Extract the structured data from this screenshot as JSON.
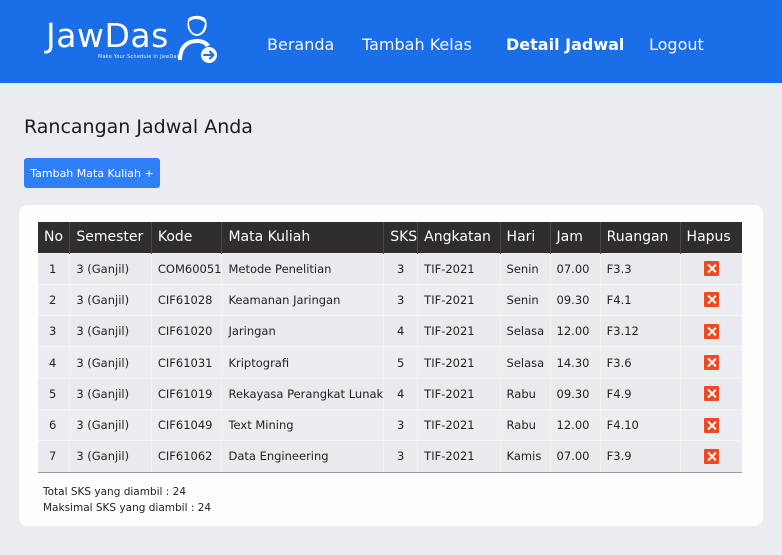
{
  "nav": {
    "brand": "JawDas",
    "tagline": "Make Your Schedule in JawDas",
    "links": [
      "Beranda",
      "Tambah Kelas",
      "Detail Jadwal",
      "Logout"
    ],
    "active": "Detail Jadwal"
  },
  "page": {
    "title": "Rancangan Jadwal Anda",
    "add_button": "Tambah Mata Kuliah +"
  },
  "table": {
    "headers": [
      "No",
      "Semester",
      "Kode",
      "Mata Kuliah",
      "SKS",
      "Angkatan",
      "Hari",
      "Jam",
      "Ruangan",
      "Hapus"
    ],
    "rows": [
      {
        "no": "1",
        "semester": "3 (Ganjil)",
        "kode": "COM60051",
        "matkul": "Metode Penelitian",
        "sks": "3",
        "angkatan": "TIF-2021",
        "hari": "Senin",
        "jam": "07.00",
        "ruangan": "F3.3"
      },
      {
        "no": "2",
        "semester": "3 (Ganjil)",
        "kode": "CIF61028",
        "matkul": "Keamanan Jaringan",
        "sks": "3",
        "angkatan": "TIF-2021",
        "hari": "Senin",
        "jam": "09.30",
        "ruangan": "F4.1"
      },
      {
        "no": "3",
        "semester": "3 (Ganjil)",
        "kode": "CIF61020",
        "matkul": "Jaringan",
        "sks": "4",
        "angkatan": "TIF-2021",
        "hari": "Selasa",
        "jam": "12.00",
        "ruangan": "F3.12"
      },
      {
        "no": "4",
        "semester": "3 (Ganjil)",
        "kode": "CIF61031",
        "matkul": "Kriptografi",
        "sks": "5",
        "angkatan": "TIF-2021",
        "hari": "Selasa",
        "jam": "14.30",
        "ruangan": "F3.6"
      },
      {
        "no": "5",
        "semester": "3 (Ganjil)",
        "kode": "CIF61019",
        "matkul": "Rekayasa Perangkat Lunak",
        "sks": "4",
        "angkatan": "TIF-2021",
        "hari": "Rabu",
        "jam": "09.30",
        "ruangan": "F4.9"
      },
      {
        "no": "6",
        "semester": "3 (Ganjil)",
        "kode": "CIF61049",
        "matkul": "Text Mining",
        "sks": "3",
        "angkatan": "TIF-2021",
        "hari": "Rabu",
        "jam": "12.00",
        "ruangan": "F4.10"
      },
      {
        "no": "7",
        "semester": "3 (Ganjil)",
        "kode": "CIF61062",
        "matkul": "Data Engineering",
        "sks": "3",
        "angkatan": "TIF-2021",
        "hari": "Kamis",
        "jam": "07.00",
        "ruangan": "F3.9"
      }
    ]
  },
  "summary": {
    "total_sks": "Total SKS yang diambil : 24",
    "max_sks": "Maksimal SKS yang diambil : 24"
  },
  "colors": {
    "navbar": "#1a6fe8",
    "button": "#2f80f4",
    "table_header": "#2f2d2d",
    "delete": "#f0491f"
  }
}
